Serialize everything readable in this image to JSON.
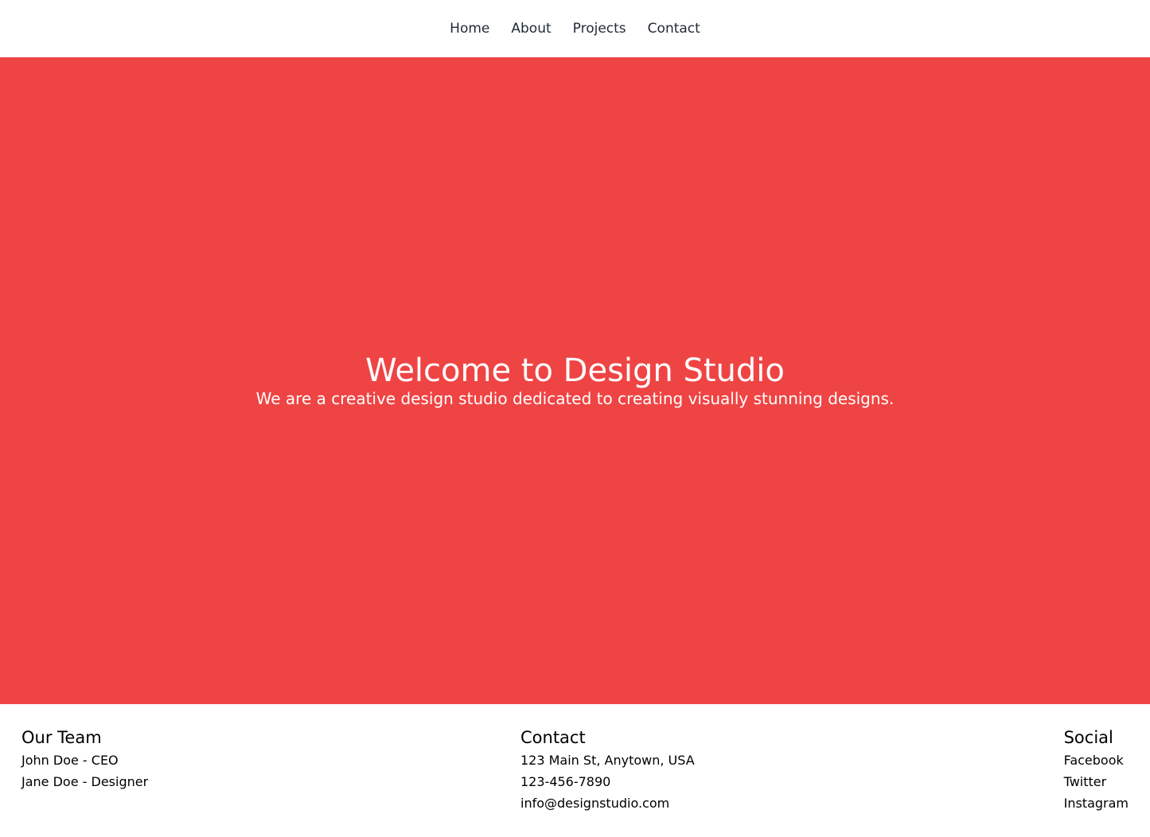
{
  "nav": {
    "items": [
      "Home",
      "About",
      "Projects",
      "Contact"
    ]
  },
  "hero": {
    "title": "Welcome to Design Studio",
    "subtitle": "We are a creative design studio dedicated to creating visually stunning designs.",
    "background_color": "#ef4444"
  },
  "footer": {
    "team": {
      "heading": "Our Team",
      "members": [
        "John Doe - CEO",
        "Jane Doe - Designer"
      ]
    },
    "contact": {
      "heading": "Contact",
      "address": "123 Main St, Anytown, USA",
      "phone": "123-456-7890",
      "email": "info@designstudio.com"
    },
    "social": {
      "heading": "Social",
      "links": [
        "Facebook",
        "Twitter",
        "Instagram"
      ]
    }
  }
}
